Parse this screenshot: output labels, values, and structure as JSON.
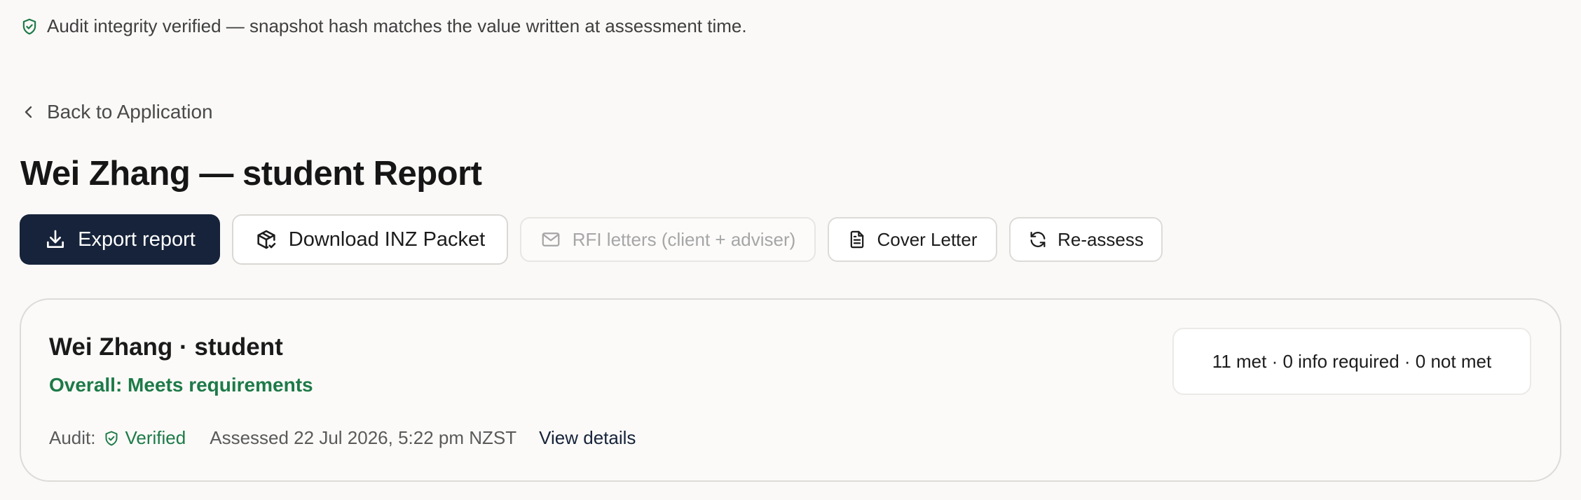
{
  "banner": {
    "icon": "shield-check-icon",
    "text": "Audit integrity verified — snapshot hash matches the value written at assessment time."
  },
  "back_link": {
    "icon": "chevron-left-icon",
    "label": "Back to Application"
  },
  "page_title": "Wei Zhang — student Report",
  "toolbar": {
    "export_label": "Export report",
    "download_packet_label": "Download INZ Packet",
    "rfi_letters_label": "RFI letters (client + adviser)",
    "cover_letter_label": "Cover Letter",
    "reassess_label": "Re-assess"
  },
  "summary_card": {
    "title": "Wei Zhang · student",
    "overall": "Overall: Meets requirements",
    "audit_label": "Audit:",
    "audit_status": "Verified",
    "assessed": "Assessed 22 Jul 2026, 5:22 pm NZST",
    "view_details_label": "View details",
    "counts": "11 met · 0 info required · 0 not met"
  },
  "colors": {
    "background": "#faf9f7",
    "primary_button": "#16233a",
    "success_green": "#1d7a48",
    "border": "#dcdbd8"
  }
}
